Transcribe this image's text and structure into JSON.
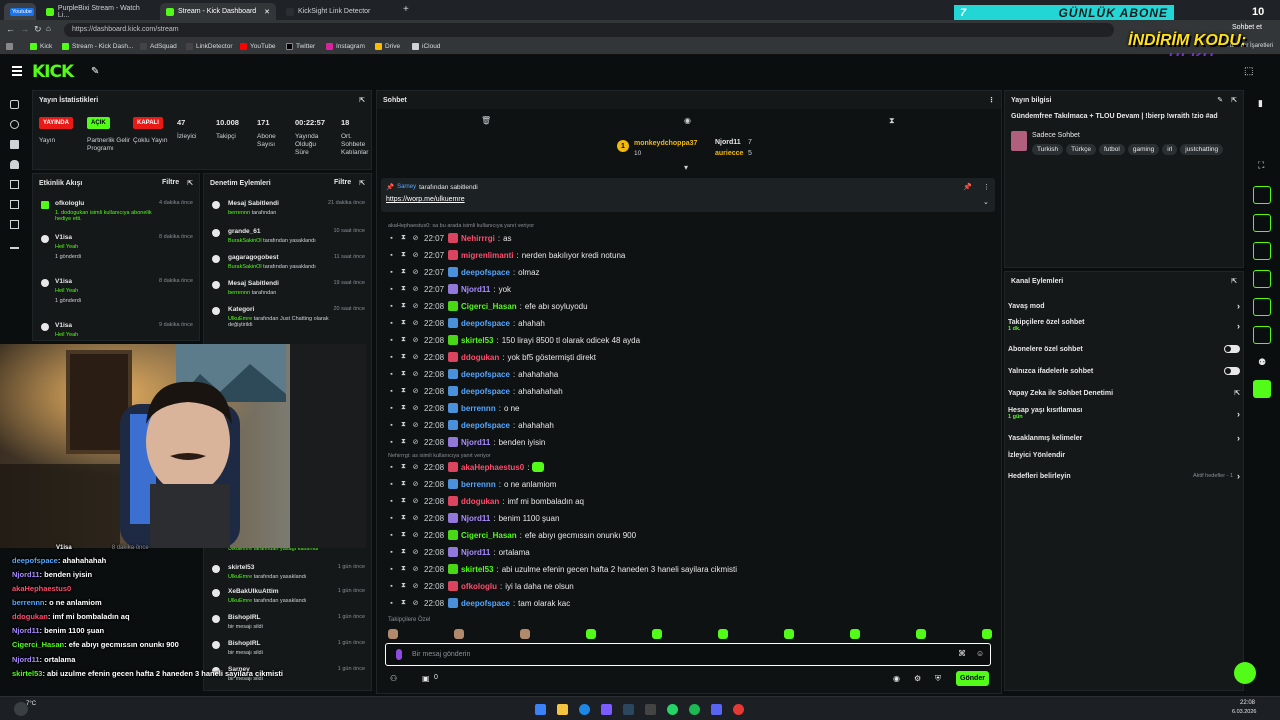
{
  "browser": {
    "tabs": [
      {
        "label": "Youtube"
      },
      {
        "label": "PurpleBixi Stream - Watch Li..."
      },
      {
        "label": "Stream - Kick Dashboard"
      },
      {
        "label": "KickSight Link Detector"
      }
    ],
    "url": "https://dashboard.kick.com/stream",
    "bookmarks": [
      "Kick",
      "Stream - Kick Dash...",
      "AdSquad",
      "LinkDetector",
      "YouTube",
      "Twitter",
      "Instagram",
      "Drive",
      "iCloud"
    ]
  },
  "overlay": {
    "daily_sub_label": "GÜNLÜK ABONE",
    "daily_sub_count_left": "7",
    "daily_sub_count_right": "10",
    "promo_title": "İNDİRİM KODU:",
    "promo_code": "ULKU",
    "chat_topright": "Sohbet et",
    "bookmarks_more": "Tüm Yer İşaretleri"
  },
  "stats": {
    "title": "Yayın İstatistikleri",
    "badges": [
      {
        "label": "YAYINDA",
        "caption": "Yayın",
        "color": "#e91916"
      },
      {
        "label": "AÇIK",
        "caption": "Partnerlik Gelir Programı",
        "color": "#53fc18"
      },
      {
        "label": "KAPALI",
        "caption": "Çoklu Yayın",
        "color": "#e91916"
      }
    ],
    "numbers": [
      {
        "value": "47",
        "caption": "İzleyici"
      },
      {
        "value": "10.008",
        "caption": "Takipçi"
      },
      {
        "value": "171",
        "caption": "Abone Sayısı"
      },
      {
        "value": "00:22:57",
        "caption": "Yayında Olduğu Süre"
      },
      {
        "value": "18",
        "caption": "Ort. Sohbete Katılanlar"
      }
    ]
  },
  "activity": {
    "title": "Etkinlik Akışı",
    "filter": "Filtre",
    "items": [
      {
        "user": "ofkologlu",
        "detail": "1. dodogukan isimli kullanıcıya abonelik hediye etti.",
        "time": "4 dakika önce"
      },
      {
        "user": "V1isa",
        "detail": "Heil Yeah",
        "extra": "1 gönderdi",
        "time": "8 dakika önce"
      },
      {
        "user": "V1isa",
        "detail": "Heil Yeah",
        "extra": "1 gönderdi",
        "time": "8 dakika önce"
      },
      {
        "user": "V1isa",
        "detail": "Heil Yeah",
        "time": "9 dakika önce"
      }
    ]
  },
  "moderation": {
    "title": "Denetim Eylemleri",
    "filter": "Filtre",
    "items": [
      {
        "title": "Mesaj Sabitlendi",
        "by": "berrennn",
        "rest": "tarafından",
        "time": "21 dakika önce"
      },
      {
        "title": "grande_61",
        "by": "BurakSakinOl",
        "rest": "tarafından yasaklandı",
        "time": "10 saat önce"
      },
      {
        "title": "gagaragogobest",
        "by": "BurakSakinOl",
        "rest": "tarafından yasaklandı",
        "time": "11 saat önce"
      },
      {
        "title": "Mesaj Sabitlendi",
        "by": "berrennn",
        "rest": "tarafından",
        "time": "19 saat önce"
      },
      {
        "title": "Kategori",
        "by": "UlkuEmre",
        "rest": "tarafından Just Chatting olarak değiştirildi",
        "time": "20 saat önce"
      }
    ],
    "lower_items": [
      {
        "title": "UlkuEmre tarafından yasağı kaldırıldı",
        "time": ""
      },
      {
        "title": "skirtel53",
        "by": "UlkuEmre",
        "rest": "tarafından yasaklandı",
        "time": "1 gün önce"
      },
      {
        "title": "XeBakUlkuAttim",
        "by": "UlkuEmre",
        "rest": "tarafından yasaklandı",
        "time": "1 gün önce"
      },
      {
        "title": "BishopIRL",
        "by": "",
        "rest": "bir mesajı sildi",
        "time": "1 gün önce"
      },
      {
        "title": "BishopIRL",
        "by": "",
        "rest": "bir mesajı sildi",
        "time": "1 gün önce"
      },
      {
        "title": "Sarney",
        "by": "",
        "rest": "bir mesajı sildi",
        "time": "1 gün önce"
      }
    ]
  },
  "chat": {
    "title": "Sohbet",
    "leaders": [
      {
        "rank": "1",
        "name": "monkeydchoppa37",
        "count": "10"
      },
      {
        "name": "Njord11",
        "count": "7"
      },
      {
        "name": "auriecce",
        "count": "5"
      }
    ],
    "pinned": {
      "by": "Sarney",
      "text": "tarafından sabitlendi",
      "link": "https://worp.me/ulkuemre"
    },
    "reply_note_1": "akaHephaestus0: sa bu arada isimli kullanıcıya yanıt veriyor",
    "reply_note_2": "Nehirrrgi: as isimli kullanıcıya yanıt veriyor",
    "messages": [
      {
        "time": "22:07",
        "user": "Nehirrrgi",
        "color": "#ff4d6d",
        "text": "as"
      },
      {
        "time": "22:07",
        "user": "migrenlimanti",
        "color": "#ff4d6d",
        "text": "nerden bakılıyor kredi notuna"
      },
      {
        "time": "22:07",
        "user": "deepofspace",
        "color": "#55a7ff",
        "text": "olmaz"
      },
      {
        "time": "22:07",
        "user": "Njord11",
        "color": "#a98bff",
        "text": "yok"
      },
      {
        "time": "22:08",
        "user": "Cigerci_Hasan",
        "color": "#53fc18",
        "text": "efe abı soyluyodu"
      },
      {
        "time": "22:08",
        "user": "deepofspace",
        "color": "#55a7ff",
        "text": "ahahah"
      },
      {
        "time": "22:08",
        "user": "skirtel53",
        "color": "#53fc18",
        "text": "150 lirayi 8500 tl olarak odicek 48 ayda"
      },
      {
        "time": "22:08",
        "user": "ddogukan",
        "color": "#ff4d6d",
        "text": "yok bf5 göstermişti direkt"
      },
      {
        "time": "22:08",
        "user": "deepofspace",
        "color": "#55a7ff",
        "text": "ahahahaha"
      },
      {
        "time": "22:08",
        "user": "deepofspace",
        "color": "#55a7ff",
        "text": "ahahahahah"
      },
      {
        "time": "22:08",
        "user": "berrennn",
        "color": "#55a7ff",
        "text": "o ne"
      },
      {
        "time": "22:08",
        "user": "deepofspace",
        "color": "#55a7ff",
        "text": "ahahahah"
      },
      {
        "time": "22:08",
        "user": "Njord11",
        "color": "#a98bff",
        "text": "benden iyisin"
      },
      {
        "time": "22:08",
        "user": "akaHephaestus0",
        "color": "#ff4d6d",
        "text": ""
      },
      {
        "time": "22:08",
        "user": "berrennn",
        "color": "#55a7ff",
        "text": "o ne anlamiom"
      },
      {
        "time": "22:08",
        "user": "ddogukan",
        "color": "#ff4d6d",
        "text": "imf mi bombaladın aq"
      },
      {
        "time": "22:08",
        "user": "Njord11",
        "color": "#a98bff",
        "text": "benim 1100 şuan"
      },
      {
        "time": "22:08",
        "user": "Cigerci_Hasan",
        "color": "#53fc18",
        "text": "efe abıyı gecmıssın onunkı 900"
      },
      {
        "time": "22:08",
        "user": "Njord11",
        "color": "#a98bff",
        "text": "ortalama"
      },
      {
        "time": "22:08",
        "user": "skirtel53",
        "color": "#53fc18",
        "text": "abi uzulme efenin gecen hafta 2 haneden 3 haneli sayilara cikmisti"
      },
      {
        "time": "22:08",
        "user": "ofkologlu",
        "color": "#ff4d6d",
        "text": "iyi la daha ne olsun"
      },
      {
        "time": "22:08",
        "user": "deepofspace",
        "color": "#55a7ff",
        "text": "tam olarak kac"
      }
    ],
    "followers_only": "Takipçilere Özel",
    "input_placeholder": "Bir mesaj gönderin",
    "viewer_count": "0",
    "send_label": "Gönder"
  },
  "stream_info": {
    "title": "Yayın bilgisi",
    "stream_title": "Gündemfree Takılmaca + TLOU Devam | !bierp !wraith !zio #ad",
    "category": "Sadece Sohbet",
    "tags": [
      "Turkish",
      "Türkçe",
      "futbol",
      "gaming",
      "irl",
      "justchatting"
    ]
  },
  "channel_actions": {
    "title": "Kanal Eylemleri",
    "items": [
      {
        "label": "Yavaş mod",
        "kind": "chevron"
      },
      {
        "label": "Takipçilere özel sohbet",
        "sub": "1 dk.",
        "kind": "chevron"
      },
      {
        "label": "Abonelere özel sohbet",
        "kind": "toggle"
      },
      {
        "label": "Yalnızca ifadelerle sohbet",
        "kind": "toggle"
      },
      {
        "label": "Yapay Zeka ile Sohbet Denetimi",
        "kind": "external"
      },
      {
        "label": "Hesap yaşı kısıtlaması",
        "sub": "1 gün",
        "kind": "chevron"
      },
      {
        "label": "Yasaklanmış kelimeler",
        "kind": "chevron"
      },
      {
        "label": "İzleyici Yönlendir",
        "kind": "none"
      },
      {
        "label": "Hedefleri belirleyin",
        "sub_right": "Aktif hedefler - 1",
        "kind": "chevron"
      }
    ]
  },
  "cam_chat": [
    {
      "user": "V1isa",
      "text": "",
      "time": "8 dakika önce",
      "color": "#ffffff"
    },
    {
      "user": "deepofspace",
      "text": "ahahahahah",
      "color": "#55a7ff"
    },
    {
      "user": "Njord11",
      "text": "benden iyisin",
      "color": "#a98bff"
    },
    {
      "user": "akaHephaestus0",
      "text": "",
      "color": "#ff4d6d"
    },
    {
      "user": "berrennn",
      "text": "o ne anlamiom",
      "color": "#55a7ff"
    },
    {
      "user": "ddogukan",
      "text": "imf mi bombaladın aq",
      "color": "#ff4d6d"
    },
    {
      "user": "Njord11",
      "text": "benim 1100 şuan",
      "color": "#a98bff"
    },
    {
      "user": "Cigerci_Hasan",
      "text": "efe abıyı gecmıssın onunkı 900",
      "color": "#53fc18"
    },
    {
      "user": "Njord11",
      "text": "ortalama",
      "color": "#a98bff"
    },
    {
      "user": "skirtel53",
      "text": "abi uzulme efenin gecen hafta 2 haneden 3 haneli sayilara cikmisti",
      "color": "#53fc18"
    },
    {
      "user": "ofkologlu",
      "text": "iyi la daha ne olsun",
      "color": "#ff4d6d"
    },
    {
      "user": "deepofspace",
      "text": "tam olarak kac",
      "color": "#55a7ff"
    }
  ],
  "taskbar": {
    "time": "22:08",
    "date": "6.03.2026",
    "weather": "7°C"
  },
  "colors": {
    "brand": "#53fc18",
    "panel": "#141819",
    "bg": "#0b0e0f",
    "live_red": "#e91916"
  }
}
